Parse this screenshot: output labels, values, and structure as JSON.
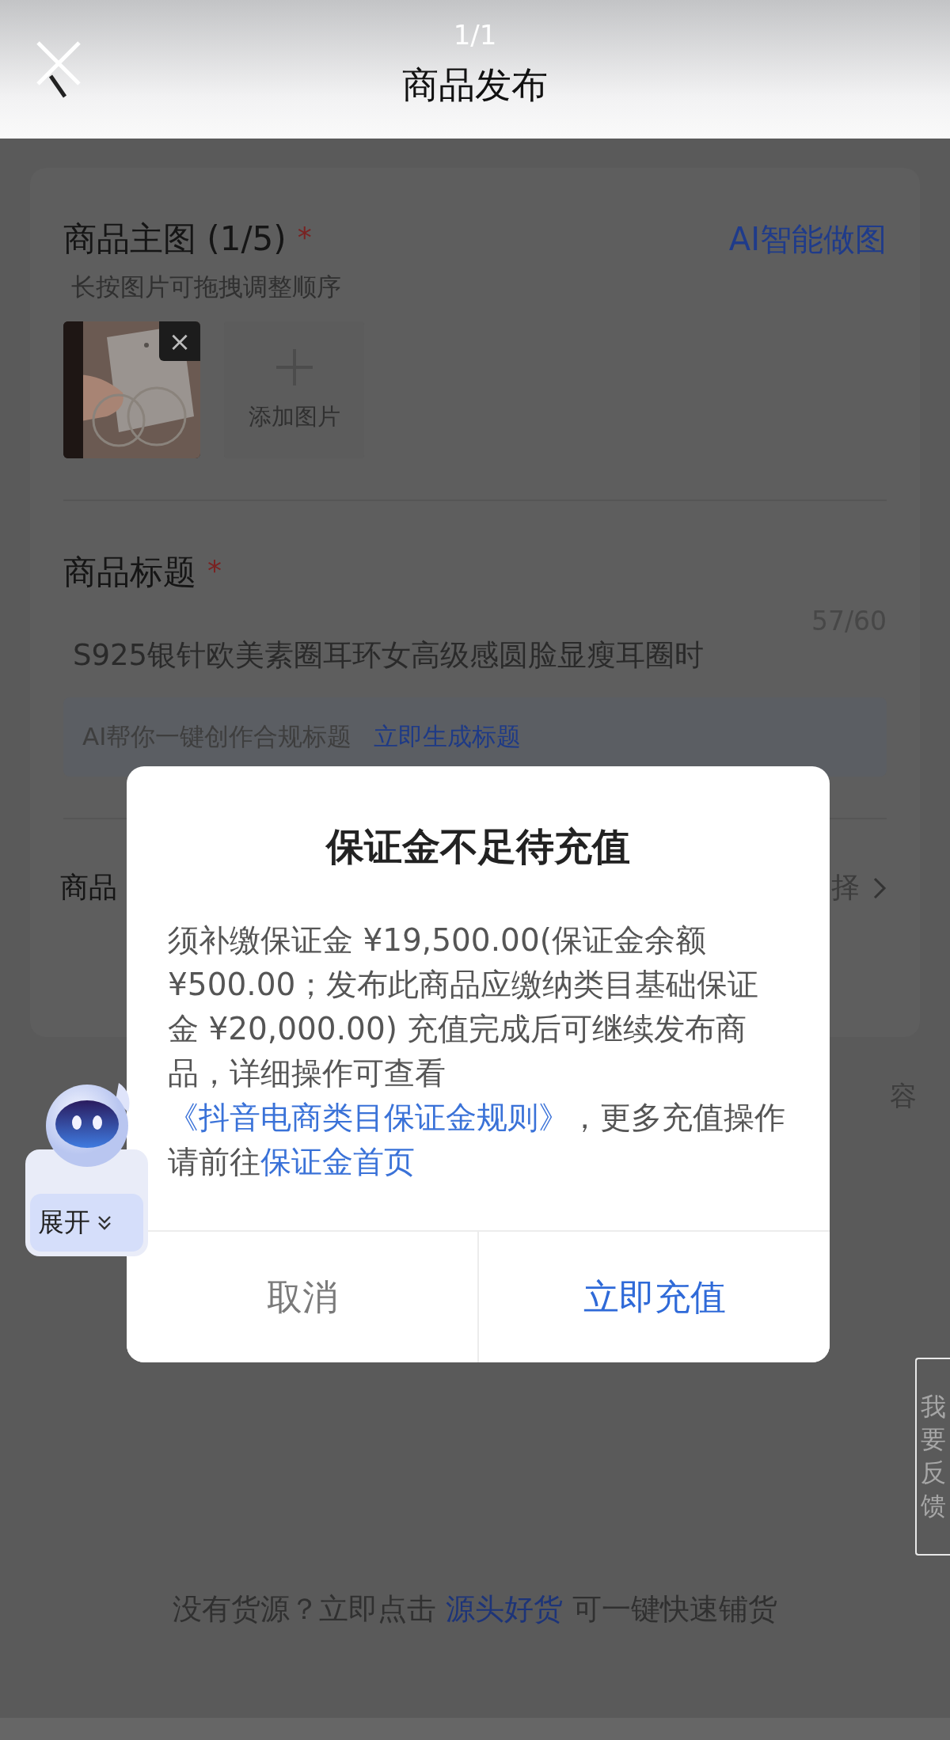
{
  "header": {
    "counter": "1/1",
    "title": "商品发布"
  },
  "main_images": {
    "label": "商品主图 (1/5)",
    "required_mark": "*",
    "ai_link": "AI智能做图",
    "hint": "长按图片可拖拽调整顺序",
    "images": [
      {
        "kind": "picture",
        "remove": "×"
      }
    ],
    "add_label": "添加图片"
  },
  "title_field": {
    "label": "商品标题",
    "required_mark": "*",
    "counter": "57/60",
    "value": "S925银针欧美素圈耳环女高级感圆脸显瘦耳圈时",
    "ai_hint": "AI帮你一键创作合规标题",
    "ai_action": "立即生成标题"
  },
  "partial_row": {
    "label": "商品",
    "value": "择"
  },
  "partial_fragment": "容",
  "dialog": {
    "title": "保证金不足待充值",
    "body": [
      {
        "kind": "text",
        "text": "须补缴保证金 ¥19,500.00(保证金余额 ¥500.00；发布此商品应缴纳类目基础保证金 ¥20,000.00) 充值完成后可继续发布商品，详细操作可查看"
      },
      {
        "kind": "link",
        "text": "《抖音电商类目保证金规则》"
      },
      {
        "kind": "text",
        "text": "，更多充值操作请前往"
      },
      {
        "kind": "link",
        "text": "保证金首页"
      }
    ],
    "buttons": [
      {
        "label": "取消",
        "kind": "secondary"
      },
      {
        "label": "立即充值",
        "kind": "primary"
      }
    ]
  },
  "assistant": {
    "label": "展开"
  },
  "feedback": "我要反馈",
  "footer": [
    {
      "kind": "text",
      "text": "没有货源？立即点击"
    },
    {
      "kind": "link",
      "text": "源头好货"
    },
    {
      "kind": "text",
      "text": "可一键快速铺货"
    }
  ]
}
